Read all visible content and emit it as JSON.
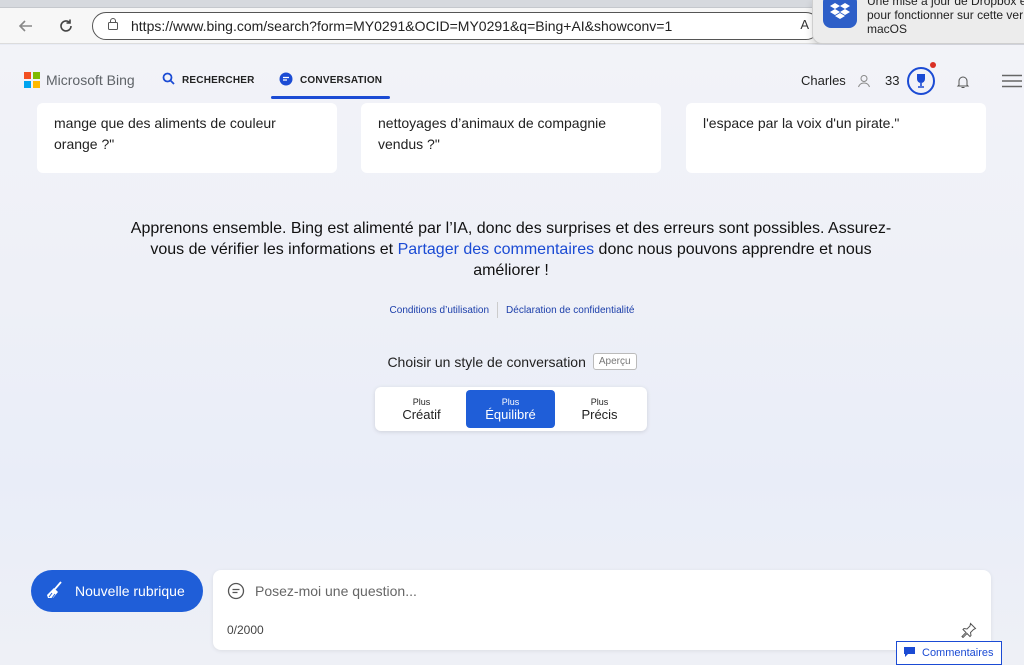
{
  "browser": {
    "url": "https://www.bing.com/search?form=MY0291&OCID=MY0291&q=Bing+AI&showconv=1",
    "read_aloud": "A"
  },
  "notification": {
    "line1": "Une mise à jour de Dropbox e",
    "line2": "pour fonctionner sur cette ver",
    "line3": "macOS"
  },
  "header": {
    "brand": "Microsoft Bing",
    "tabs": [
      {
        "label": "RECHERCHER"
      },
      {
        "label": "CONVERSATION"
      }
    ],
    "user_name": "Charles",
    "points": "33"
  },
  "cards": [
    {
      "line1": "mange que des aliments de couleur",
      "line2": "orange ?\""
    },
    {
      "line1": "nettoyages d’animaux de compagnie",
      "line2": "vendus ?\""
    },
    {
      "line1": "l'espace par la voix d'un pirate.\"",
      "line2": ""
    }
  ],
  "disclaimer": {
    "part1": "Apprenons ensemble. Bing est alimenté par l’IA, donc des surprises et des erreurs sont possibles. Assurez-vous de vérifier les informations et ",
    "link": "Partager des commentaires",
    "part2": " donc nous pouvons apprendre et nous améliorer !"
  },
  "legal": {
    "terms": "Conditions d’utilisation",
    "privacy": "Déclaration de confidentialité"
  },
  "style_picker": {
    "title": "Choisir un style de conversation",
    "badge": "Aperçu",
    "options": [
      {
        "small": "Plus",
        "label": "Créatif"
      },
      {
        "small": "Plus",
        "label": "Équilibré"
      },
      {
        "small": "Plus",
        "label": "Précis"
      }
    ]
  },
  "composer": {
    "new_topic": "Nouvelle rubrique",
    "placeholder": "Posez-moi une question...",
    "counter": "0/2000"
  },
  "feedback": "Commentaires",
  "colors": {
    "accent": "#1f5ed8",
    "link": "#1b4bd4"
  }
}
